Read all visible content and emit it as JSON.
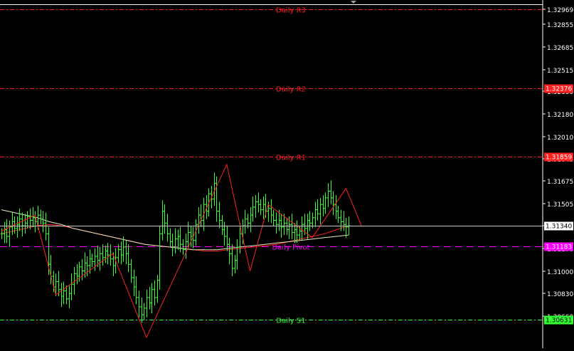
{
  "chart_data": {
    "type": "line",
    "instrument_scale": {
      "ylim": [
        1.3043,
        1.33
      ]
    },
    "price_axis": {
      "ticks": [
        "1.32969",
        "1.32855",
        "1.32685",
        "1.32515",
        "1.32350",
        "1.32180",
        "1.32010",
        "1.31845",
        "1.31675",
        "1.31505",
        "1.31340",
        "1.31170",
        "1.31000",
        "1.30830",
        "1.30660"
      ]
    },
    "current_price": {
      "value": 1.3134,
      "label": "1.31340",
      "line_color": "#c8c8c8"
    },
    "pivot_levels": [
      {
        "name": "Daily R3",
        "value": 1.3297,
        "tag": "",
        "color": "#ff2020",
        "dash": "6 3 2 3"
      },
      {
        "name": "Daily R2",
        "value": 1.32376,
        "tag": "1.32376",
        "color": "#ff2020",
        "dash": "6 3 2 3"
      },
      {
        "name": "Daily R1",
        "value": 1.31859,
        "tag": "1.31859",
        "color": "#ff2020",
        "dash": "6 3 2 3"
      },
      {
        "name": "Daily Pivot",
        "value": 1.31183,
        "tag": "1.31183",
        "color": "#ff00ff",
        "dash": "10 6"
      },
      {
        "name": "Daily S1",
        "value": 1.30631,
        "tag": "1.30631",
        "color": "#33ff33",
        "dash": "6 3 2 3"
      }
    ],
    "price_series": {
      "color": "#33ff33",
      "values": [
        1.3128,
        1.3131,
        1.3126,
        1.3133,
        1.3137,
        1.3132,
        1.3135,
        1.3139,
        1.3134,
        1.3136,
        1.3141,
        1.3138,
        1.314,
        1.3137,
        1.3142,
        1.3139,
        1.3136,
        1.3128,
        1.3105,
        1.3096,
        1.3088,
        1.3092,
        1.3086,
        1.3081,
        1.3085,
        1.3079,
        1.3083,
        1.309,
        1.3098,
        1.3096,
        1.3103,
        1.31,
        1.3106,
        1.3104,
        1.3109,
        1.3107,
        1.3111,
        1.3108,
        1.3113,
        1.311,
        1.3115,
        1.3112,
        1.3109,
        1.3104,
        1.311,
        1.3116,
        1.3112,
        1.3118,
        1.3113,
        1.3105,
        1.3095,
        1.3088,
        1.308,
        1.3073,
        1.3067,
        1.3072,
        1.308,
        1.3076,
        1.3086,
        1.308,
        1.3093,
        1.3128,
        1.3145,
        1.3136,
        1.3128,
        1.3122,
        1.3118,
        1.3124,
        1.3126,
        1.312,
        1.3116,
        1.3122,
        1.3129,
        1.3126,
        1.3123,
        1.3135,
        1.3142,
        1.3138,
        1.315,
        1.3145,
        1.3158,
        1.3154,
        1.3166,
        1.3145,
        1.3138,
        1.3131,
        1.3126,
        1.312,
        1.3113,
        1.3102,
        1.3108,
        1.3118,
        1.3128,
        1.3134,
        1.3139,
        1.3136,
        1.3142,
        1.3148,
        1.3152,
        1.315,
        1.3146,
        1.315,
        1.3145,
        1.3147,
        1.3142,
        1.3138,
        1.3135,
        1.3138,
        1.3133,
        1.3136,
        1.3131,
        1.3135,
        1.3129,
        1.3131,
        1.3127,
        1.313,
        1.3135,
        1.3132,
        1.3138,
        1.3136,
        1.314,
        1.3146,
        1.3143,
        1.315,
        1.3147,
        1.3155,
        1.316,
        1.3155,
        1.315,
        1.3145,
        1.314,
        1.3137,
        1.3135,
        1.3133,
        1.3134
      ]
    },
    "zigzag": {
      "color": "#ff2020",
      "points": [
        [
          0,
          1.313
        ],
        [
          13,
          1.3142
        ],
        [
          21,
          1.3082
        ],
        [
          43,
          1.3113
        ],
        [
          56,
          1.305
        ],
        [
          87,
          1.318
        ],
        [
          96,
          1.31
        ],
        [
          103,
          1.315
        ],
        [
          120,
          1.3125
        ],
        [
          133,
          1.3162
        ],
        [
          139,
          1.3134
        ]
      ]
    },
    "moving_averages": [
      {
        "color": "#ff2020",
        "values": [
          1.3128,
          1.313,
          1.3132,
          1.3134,
          1.3135,
          1.3134,
          1.3132,
          1.313,
          1.3128,
          1.3126,
          1.3124,
          1.3122,
          1.312,
          1.3119,
          1.3118,
          1.3117,
          1.3116,
          1.3115,
          1.3115,
          1.3116,
          1.3117,
          1.3118,
          1.3119,
          1.312,
          1.3122,
          1.3124,
          1.3126,
          1.3128,
          1.3131,
          1.3134
        ]
      },
      {
        "color": "#e8e8c0",
        "values": [
          1.3146,
          1.3144,
          1.3142,
          1.314,
          1.3137,
          1.3135,
          1.3132,
          1.313,
          1.3128,
          1.3126,
          1.3124,
          1.3122,
          1.312,
          1.3119,
          1.3118,
          1.3117,
          1.3116,
          1.3116,
          1.3116,
          1.3117,
          1.3118,
          1.3119,
          1.312,
          1.3121,
          1.3122,
          1.3123,
          1.3124,
          1.3125,
          1.3126,
          1.3127
        ]
      }
    ],
    "grid": false,
    "colors": {
      "background": "#000000",
      "axis_text": "#ffffff"
    }
  }
}
